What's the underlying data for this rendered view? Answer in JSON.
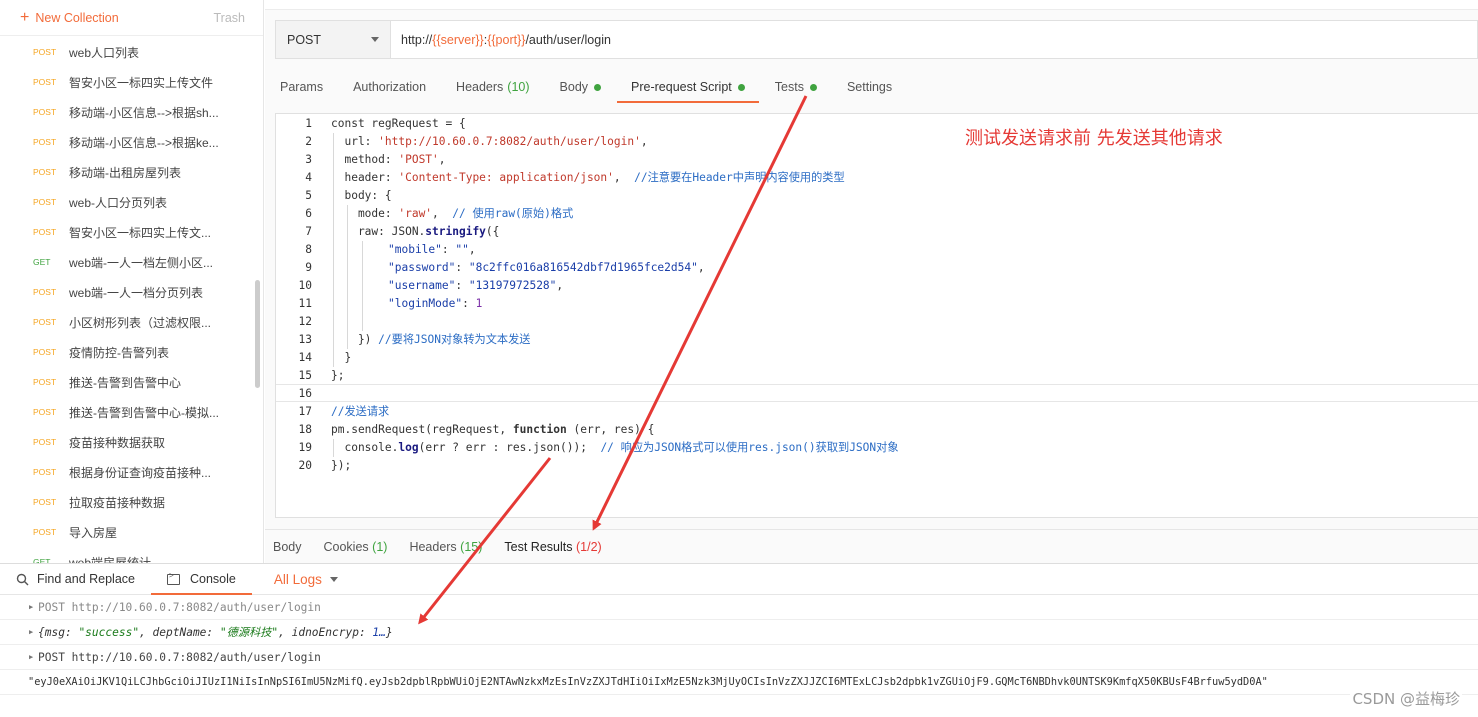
{
  "sidebar": {
    "new_collection": "New Collection",
    "trash": "Trash",
    "items": [
      {
        "method": "POST",
        "label": "web人口列表"
      },
      {
        "method": "POST",
        "label": "智安小区一标四实上传文件"
      },
      {
        "method": "POST",
        "label": "移动端-小区信息-->根据sh..."
      },
      {
        "method": "POST",
        "label": "移动端-小区信息-->根据ke..."
      },
      {
        "method": "POST",
        "label": "移动端-出租房屋列表"
      },
      {
        "method": "POST",
        "label": "web-人口分页列表"
      },
      {
        "method": "POST",
        "label": "智安小区一标四实上传文..."
      },
      {
        "method": "GET",
        "label": "web端-一人一档左侧小区..."
      },
      {
        "method": "POST",
        "label": "web端-一人一档分页列表"
      },
      {
        "method": "POST",
        "label": "小区树形列表（过滤权限..."
      },
      {
        "method": "POST",
        "label": "疫情防控-告警列表"
      },
      {
        "method": "POST",
        "label": "推送-告警到告警中心"
      },
      {
        "method": "POST",
        "label": "推送-告警到告警中心-模拟..."
      },
      {
        "method": "POST",
        "label": "疫苗接种数据获取"
      },
      {
        "method": "POST",
        "label": "根据身份证查询疫苗接种..."
      },
      {
        "method": "POST",
        "label": "拉取疫苗接种数据"
      },
      {
        "method": "POST",
        "label": "导入房屋"
      },
      {
        "method": "GET",
        "label": "web端房屋统计"
      }
    ]
  },
  "request": {
    "method": "POST",
    "url_prefix": "http://",
    "url_var1": "{{server}}",
    "url_sep": ":",
    "url_var2": "{{port}}",
    "url_path": "/auth/user/login"
  },
  "tabs": {
    "params": "Params",
    "authorization": "Authorization",
    "headers": "Headers",
    "headers_count": "(10)",
    "body": "Body",
    "prerequest": "Pre-request Script",
    "tests": "Tests",
    "settings": "Settings"
  },
  "editor": {
    "line_numbers": [
      "1",
      "2",
      "3",
      "4",
      "5",
      "6",
      "7",
      "8",
      "9",
      "10",
      "11",
      "12",
      "13",
      "14",
      "15",
      "16",
      "17",
      "18",
      "19",
      "20"
    ],
    "l1": "const regRequest = {",
    "l2_key": "  url: ",
    "l2_val": "'http://10.60.0.7:8082/auth/user/login'",
    "l2_end": ",",
    "l3_key": "  method: ",
    "l3_val": "'POST'",
    "l3_end": ",",
    "l4_key": "  header: ",
    "l4_val": "'Content-Type: application/json'",
    "l4_end": ",  ",
    "l4_comment": "//注意要在Header中声明内容使用的类型",
    "l5": "  body: {",
    "l6_key": "    mode: ",
    "l6_val": "'raw'",
    "l6_end": ",  ",
    "l6_comment": "// 使用raw(原始)格式",
    "l7_a": "    raw: JSON.",
    "l7_fn": "stringify",
    "l7_b": "({",
    "l8_key": "\"mobile\"",
    "l8_val": "\"\"",
    "l9_key": "\"password\"",
    "l9_val": "\"8c2ffc016a816542dbf7d1965fce2d54\"",
    "l10_key": "\"username\"",
    "l10_val": "\"13197972528\"",
    "l11_key": "\"loginMode\"",
    "l11_val": "1",
    "l13_a": "    }) ",
    "l13_comment": "//要将JSON对象转为文本发送",
    "l14": "  }",
    "l15": "};",
    "l17_comment": "//发送请求",
    "l18_a": "pm.sendRequest(regRequest, ",
    "l18_kw": "function",
    "l18_b": " (err, res) {",
    "l19_a": "  console.",
    "l19_fn": "log",
    "l19_b": "(err ? err : res.json());  ",
    "l19_comment": "// 响应为JSON格式可以使用res.json()获取到JSON对象",
    "l20": "});"
  },
  "annotation": "测试发送请求前 先发送其他请求",
  "response_tabs": {
    "body": "Body",
    "cookies": "Cookies",
    "cookies_count": "(1)",
    "headers": "Headers",
    "headers_count": "(15)",
    "test_results": "Test Results",
    "test_results_count": "(1/2)"
  },
  "console": {
    "find_replace": "Find and Replace",
    "console_tab": "Console",
    "all_logs": "All Logs",
    "log1": "POST http://10.60.0.7:8082/auth/user/login",
    "log2_open": "{",
    "log2_k1": "msg: ",
    "log2_v1": "\"success\"",
    "log2_k2": ", deptName: ",
    "log2_v2": "\"德源科技\"",
    "log2_k3": ", idnoEncryp: ",
    "log2_v3": "1…",
    "log2_close": "}",
    "log3": "POST http://10.60.0.7:8082/auth/user/login",
    "log4": "\"eyJ0eXAiOiJKV1QiLCJhbGciOiJIUzI1NiIsInNpSI6ImU5NzMifQ.eyJsb2dpblRpbWUiOjE2NTAwNzkxMzEsInVzZXJTdHIiOiIxMzE5Nzk3MjUyOCIsInVzZXJJZCI6MTExLCJsb2dpbk1vZGUiOjF9.GQMcT6NBDhvk0UNTSK9KmfqX50KBUsF4Brfuw5ydD0A\""
  },
  "watermark": "CSDN @益梅珍",
  "colors": {
    "accent": "#f26b3a",
    "post": "#f5a623",
    "get": "#3fa33f",
    "arrow": "#e53935"
  }
}
